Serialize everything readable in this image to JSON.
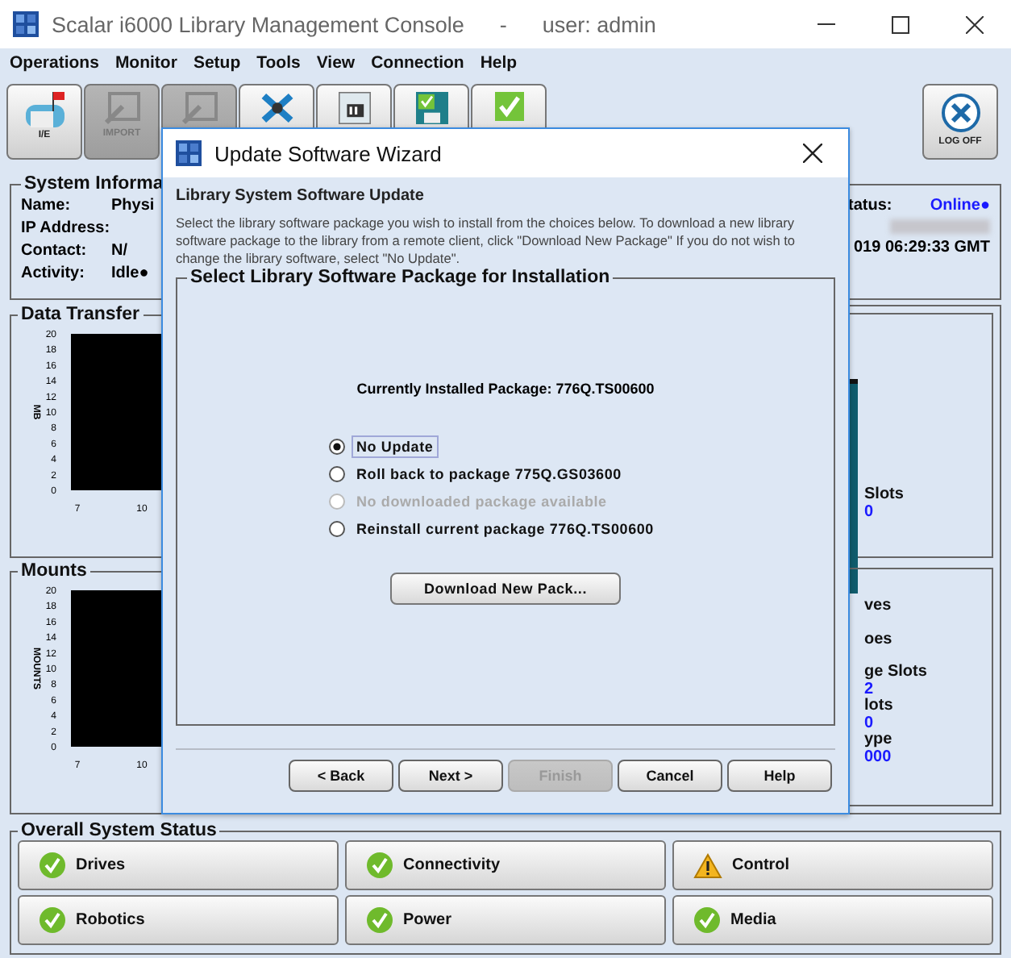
{
  "window": {
    "title": "Scalar i6000 Library Management Console",
    "separator": "-",
    "user": "user: admin"
  },
  "menu": [
    "Operations",
    "Monitor",
    "Setup",
    "Tools",
    "View",
    "Connection",
    "Help"
  ],
  "toolbar": [
    {
      "kind": "ie",
      "label": "I/E",
      "disabled": false
    },
    {
      "kind": "import",
      "label": "IMPORT",
      "disabled": true
    },
    {
      "kind": "export",
      "disabled": true
    },
    {
      "kind": "tools",
      "disabled": false
    },
    {
      "kind": "library",
      "disabled": false
    },
    {
      "kind": "save",
      "disabled": false
    },
    {
      "kind": "system",
      "disabled": false
    }
  ],
  "logoff": {
    "label": "LOG OFF"
  },
  "system_info": {
    "title": "System Informa",
    "fields": [
      {
        "label": "Name:",
        "value": "Physi"
      },
      {
        "label": "IP Address:"
      },
      {
        "label": "Contact:",
        "value": "N/"
      },
      {
        "label": "Activity:",
        "value": "Idle●"
      }
    ],
    "status_label": "tatus:",
    "status_value": "Online●",
    "date": "019 06:29:33 GMT"
  },
  "data_transfer": {
    "title": "Data Transfer",
    "axis_label": "MB",
    "yticks": [
      "20",
      "18",
      "16",
      "14",
      "12",
      "10",
      "8",
      "6",
      "4",
      "2",
      "0"
    ],
    "xticks": [
      "7",
      "10"
    ]
  },
  "mounts": {
    "title": "Mounts",
    "axis_label": "MOUNTS",
    "yticks": [
      "20",
      "18",
      "16",
      "14",
      "12",
      "10",
      "8",
      "6",
      "4",
      "2",
      "0"
    ],
    "xticks": [
      "7",
      "10"
    ]
  },
  "slots_panel": {
    "items": [
      {
        "text": "Slots",
        "kind": "label"
      },
      {
        "text": "0",
        "kind": "value"
      }
    ]
  },
  "totals_panel": {
    "items": [
      {
        "text": "ves",
        "kind": "label"
      },
      {
        "text": "oes",
        "kind": "label"
      },
      {
        "text": "ge Slots",
        "kind": "label"
      },
      {
        "text": "2",
        "kind": "value"
      },
      {
        "text": "lots",
        "kind": "label"
      },
      {
        "text": "0",
        "kind": "value"
      },
      {
        "text": "ype",
        "kind": "label"
      },
      {
        "text": "000",
        "kind": "value"
      }
    ]
  },
  "overall": {
    "title": "Overall System Status",
    "items": [
      {
        "label": "Drives",
        "kind": "ok"
      },
      {
        "label": "Connectivity",
        "kind": "ok"
      },
      {
        "label": "Control",
        "kind": "warning"
      },
      {
        "label": "Robotics",
        "kind": "ok"
      },
      {
        "label": "Power",
        "kind": "ok"
      },
      {
        "label": "Media",
        "kind": "ok"
      }
    ]
  },
  "dialog": {
    "title": "Update Software Wizard",
    "heading": "Library System Software Update",
    "description": "Select the library software package you wish to install from the choices below. To download a new library software package to the library from a remote client, click \"Download New Package\" If you do not wish to change the library software, select \"No Update\".",
    "group_title": "Select Library Software Package for Installation",
    "installed": "Currently Installed Package: 776Q.TS00600",
    "options": [
      {
        "label": "No Update",
        "selected": true,
        "disabled": false
      },
      {
        "label": "Roll back to package 775Q.GS03600",
        "selected": false,
        "disabled": false
      },
      {
        "label": "No downloaded package available",
        "selected": false,
        "disabled": true
      },
      {
        "label": "Reinstall current package 776Q.TS00600",
        "selected": false,
        "disabled": false
      }
    ],
    "download_button": "Download New Pack...",
    "buttons": [
      {
        "label": "< Back",
        "disabled": false
      },
      {
        "label": "Next >",
        "disabled": false
      },
      {
        "label": "Finish",
        "disabled": true
      },
      {
        "label": "Cancel",
        "disabled": false
      },
      {
        "label": "Help",
        "disabled": false
      }
    ]
  }
}
